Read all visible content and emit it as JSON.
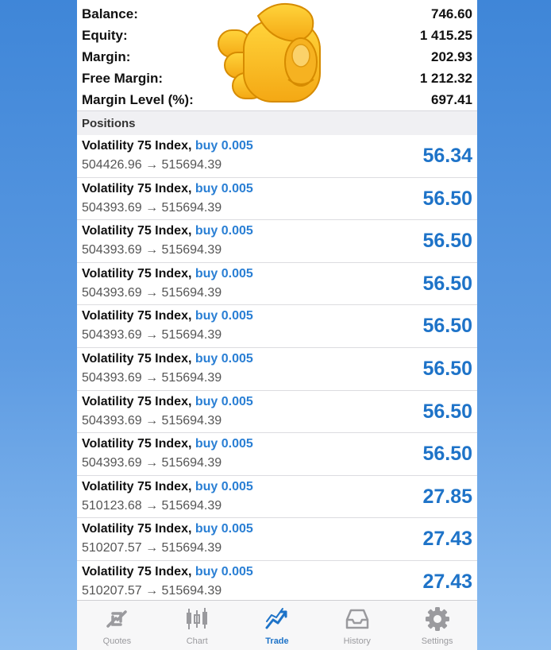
{
  "account": {
    "balance_label": "Balance:",
    "balance_value": "746.60",
    "equity_label": "Equity:",
    "equity_value": "1 415.25",
    "margin_label": "Margin:",
    "margin_value": "202.93",
    "free_margin_label": "Free Margin:",
    "free_margin_value": "1 212.32",
    "margin_level_label": "Margin Level (%):",
    "margin_level_value": "697.41"
  },
  "positions_header": "Positions",
  "positions": [
    {
      "symbol": "Volatility 75 Index,",
      "direction": "buy 0.005",
      "prices": "504426.96 → 515694.39",
      "profit": "56.34"
    },
    {
      "symbol": "Volatility 75 Index,",
      "direction": "buy 0.005",
      "prices": "504393.69 → 515694.39",
      "profit": "56.50"
    },
    {
      "symbol": "Volatility 75 Index,",
      "direction": "buy 0.005",
      "prices": "504393.69 → 515694.39",
      "profit": "56.50"
    },
    {
      "symbol": "Volatility 75 Index,",
      "direction": "buy 0.005",
      "prices": "504393.69 → 515694.39",
      "profit": "56.50"
    },
    {
      "symbol": "Volatility 75 Index,",
      "direction": "buy 0.005",
      "prices": "504393.69 → 515694.39",
      "profit": "56.50"
    },
    {
      "symbol": "Volatility 75 Index,",
      "direction": "buy 0.005",
      "prices": "504393.69 → 515694.39",
      "profit": "56.50"
    },
    {
      "symbol": "Volatility 75 Index,",
      "direction": "buy 0.005",
      "prices": "504393.69 → 515694.39",
      "profit": "56.50"
    },
    {
      "symbol": "Volatility 75 Index,",
      "direction": "buy 0.005",
      "prices": "504393.69 → 515694.39",
      "profit": "56.50"
    },
    {
      "symbol": "Volatility 75 Index,",
      "direction": "buy 0.005",
      "prices": "510123.68 → 515694.39",
      "profit": "27.85"
    },
    {
      "symbol": "Volatility 75 Index,",
      "direction": "buy 0.005",
      "prices": "510207.57 → 515694.39",
      "profit": "27.43"
    },
    {
      "symbol": "Volatility 75 Index,",
      "direction": "buy 0.005",
      "prices": "510207.57 → 515694.39",
      "profit": "27.43"
    }
  ],
  "tabs": [
    {
      "label": "Quotes",
      "icon": "quotes-icon"
    },
    {
      "label": "Chart",
      "icon": "chart-icon"
    },
    {
      "label": "Trade",
      "icon": "trade-icon",
      "active": true
    },
    {
      "label": "History",
      "icon": "history-icon"
    },
    {
      "label": "Settings",
      "icon": "gear-icon"
    }
  ],
  "colors": {
    "accent": "#1e73c8",
    "buy": "#2a7fd4",
    "tab_inactive": "#9a9a9e",
    "background": "#4a8fdc"
  }
}
